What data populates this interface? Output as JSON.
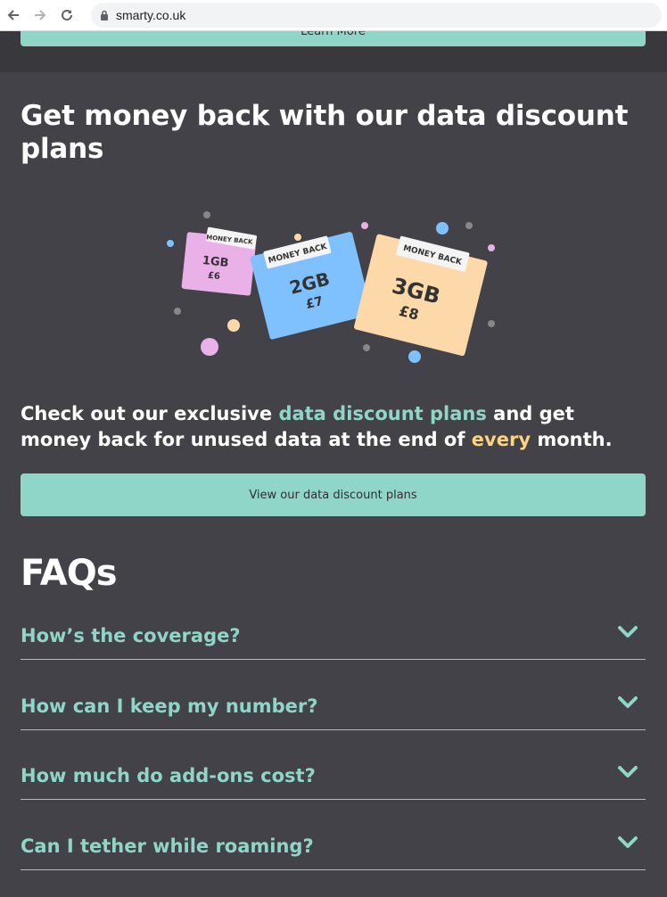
{
  "browser": {
    "url": "smarty.co.uk"
  },
  "top_button": {
    "label": "Learn More"
  },
  "section": {
    "heading": "Get money back with our data discount plans",
    "promo": {
      "part1": "Check out our exclusive ",
      "highlight1": "data discount plans",
      "part2": " and get money back for unused data at the end of ",
      "highlight2": "every",
      "part3": " month."
    },
    "cta_label": "View our data discount plans"
  },
  "illustration": {
    "cards": [
      {
        "tag": "MONEY BACK",
        "data": "1GB",
        "price": "£6",
        "color": "#eab0e8"
      },
      {
        "tag": "MONEY BACK",
        "data": "2GB",
        "price": "£7",
        "color": "#7fc1ff"
      },
      {
        "tag": "MONEY BACK",
        "data": "3GB",
        "price": "£8",
        "color": "#fdd8a8"
      }
    ]
  },
  "faqs": {
    "title": "FAQs",
    "items": [
      {
        "question": "How’s the coverage?"
      },
      {
        "question": "How can I keep my number?"
      },
      {
        "question": "How much do add-ons cost?"
      },
      {
        "question": "Can I tether while roaming?"
      }
    ]
  },
  "colors": {
    "background": "#424248",
    "accent": "#8fd6c9",
    "highlight": "#ffd27d"
  }
}
